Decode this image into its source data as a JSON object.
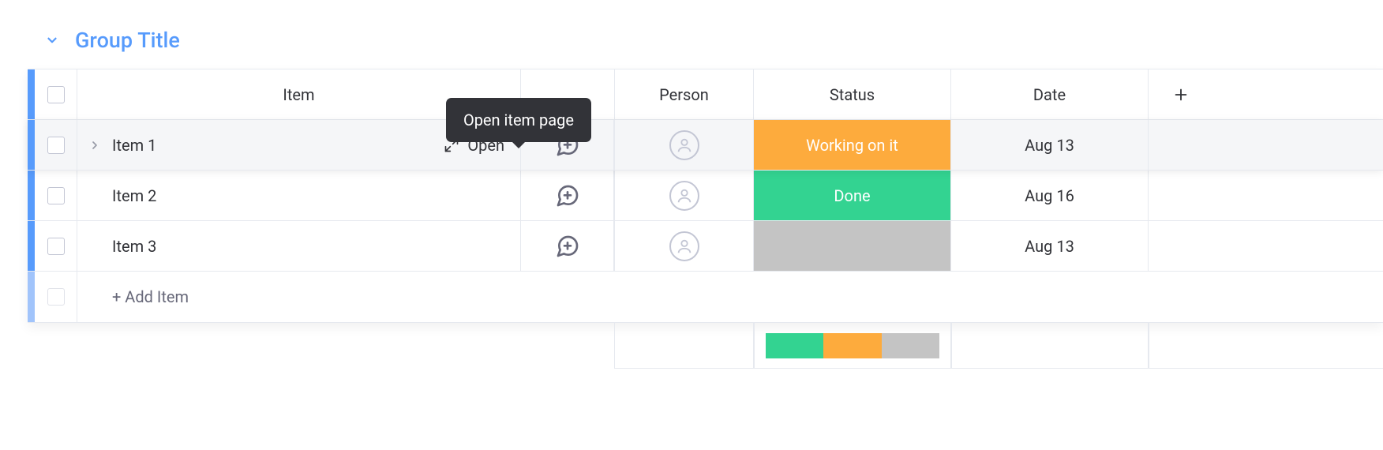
{
  "group": {
    "title": "Group Title"
  },
  "tooltip": "Open item page",
  "open_label": "Open",
  "columns": {
    "item": "Item",
    "person": "Person",
    "status": "Status",
    "date": "Date"
  },
  "add_item_label": "+ Add Item",
  "status_colors": {
    "working": "#fdab3d",
    "done": "#33d391",
    "blank": "#c4c4c4"
  },
  "rows": [
    {
      "name": "Item 1",
      "status_label": "Working on it",
      "status_color": "#fdab3d",
      "date": "Aug 13"
    },
    {
      "name": "Item 2",
      "status_label": "Done",
      "status_color": "#33d391",
      "date": "Aug 16"
    },
    {
      "name": "Item 3",
      "status_label": "",
      "status_color": "#c4c4c4",
      "date": "Aug 13"
    }
  ]
}
